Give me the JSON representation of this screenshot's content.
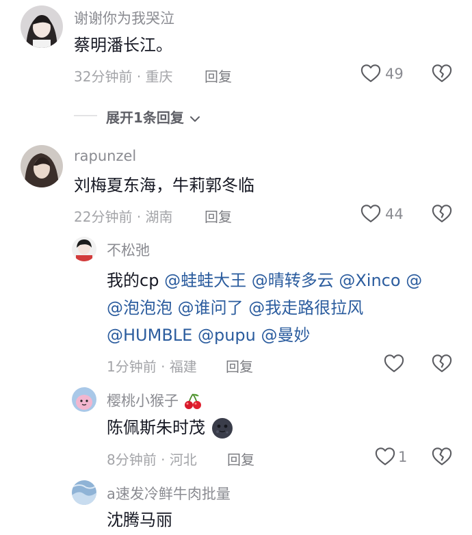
{
  "comments": [
    {
      "username": "谢谢你为我哭泣",
      "text": "蔡明潘长江。",
      "time": "32分钟前",
      "location": "重庆",
      "reply_label": "回复",
      "likes": "49",
      "expand_label": "展开1条回复"
    },
    {
      "username": "rapunzel",
      "text": "刘梅夏东海，牛莉郭冬临",
      "time": "22分钟前",
      "location": "湖南",
      "reply_label": "回复",
      "likes": "44"
    }
  ],
  "replies": [
    {
      "username": "不松弛",
      "text_prefix": "我的cp",
      "mentions": [
        "@蛙蛙大王",
        "@晴转多云",
        "@Xinco",
        "@泡泡泡",
        "@谁问了",
        "@我走路很拉风",
        "@HUMBLE",
        "@pupu",
        "@曼妙"
      ],
      "time": "1分钟前",
      "location": "福建",
      "reply_label": "回复",
      "likes": ""
    },
    {
      "username": "樱桃小猴子",
      "username_emoji": "cherries-emoji",
      "text": "陈佩斯朱时茂",
      "text_emoji": "dark-moon-face-emoji",
      "time": "8分钟前",
      "location": "河北",
      "reply_label": "回复",
      "likes": "1"
    },
    {
      "username": "a速发冷鲜牛肉批量",
      "text": "沈腾马丽"
    }
  ],
  "meta_separator": "·",
  "colors": {
    "primary_text": "#161823",
    "secondary_text": "#8a8b91",
    "mention": "#2b5c9e"
  }
}
